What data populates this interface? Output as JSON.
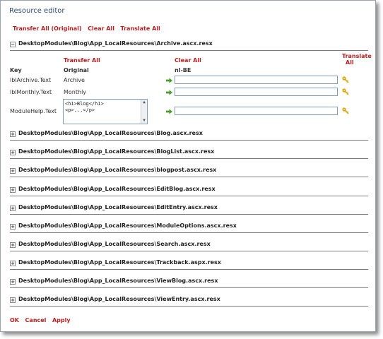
{
  "title": "Resource editor",
  "toolbar": {
    "transfer_all_original": "Transfer All (Original)",
    "clear_all": "Clear All",
    "translate_all": "Translate All"
  },
  "expanded_section": {
    "toggle": "−",
    "path": "DesktopModules\\Blog\\App_LocalResources\\Archive.ascx.resx",
    "col_transfer_all": "Transfer All",
    "col_clear_all": "Clear All",
    "col_translate_all_1": "Translate",
    "col_translate_all_2": "All",
    "col_key": "Key",
    "col_original": "Original",
    "col_locale": "nl-BE",
    "rows": [
      {
        "key": "lblArchive.Text",
        "original": "Archive",
        "value": ""
      },
      {
        "key": "lblMonthly.Text",
        "original": "Monthly",
        "value": ""
      },
      {
        "key": "ModuleHelp.Text",
        "original": "<h1>Blog</h1>\n<p>...</p>",
        "value": ""
      }
    ]
  },
  "sections": [
    {
      "toggle": "+",
      "path": "DesktopModules\\Blog\\App_LocalResources\\Blog.ascx.resx"
    },
    {
      "toggle": "+",
      "path": "DesktopModules\\Blog\\App_LocalResources\\BlogList.ascx.resx"
    },
    {
      "toggle": "+",
      "path": "DesktopModules\\Blog\\App_LocalResources\\blogpost.ascx.resx"
    },
    {
      "toggle": "+",
      "path": "DesktopModules\\Blog\\App_LocalResources\\EditBlog.ascx.resx"
    },
    {
      "toggle": "+",
      "path": "DesktopModules\\Blog\\App_LocalResources\\EditEntry.ascx.resx"
    },
    {
      "toggle": "+",
      "path": "DesktopModules\\Blog\\App_LocalResources\\ModuleOptions.ascx.resx"
    },
    {
      "toggle": "+",
      "path": "DesktopModules\\Blog\\App_LocalResources\\Search.ascx.resx"
    },
    {
      "toggle": "+",
      "path": "DesktopModules\\Blog\\App_LocalResources\\Trackback.aspx.resx"
    },
    {
      "toggle": "+",
      "path": "DesktopModules\\Blog\\App_LocalResources\\ViewBlog.ascx.resx"
    },
    {
      "toggle": "+",
      "path": "DesktopModules\\Blog\\App_LocalResources\\ViewEntry.ascx.resx"
    }
  ],
  "footer": {
    "ok": "OK",
    "cancel": "Cancel",
    "apply": "Apply"
  },
  "colors": {
    "accent": "#b81e1e",
    "title": "#2b4f75",
    "arrow": "#4a9e2a",
    "key_icon": "#d9a400"
  }
}
